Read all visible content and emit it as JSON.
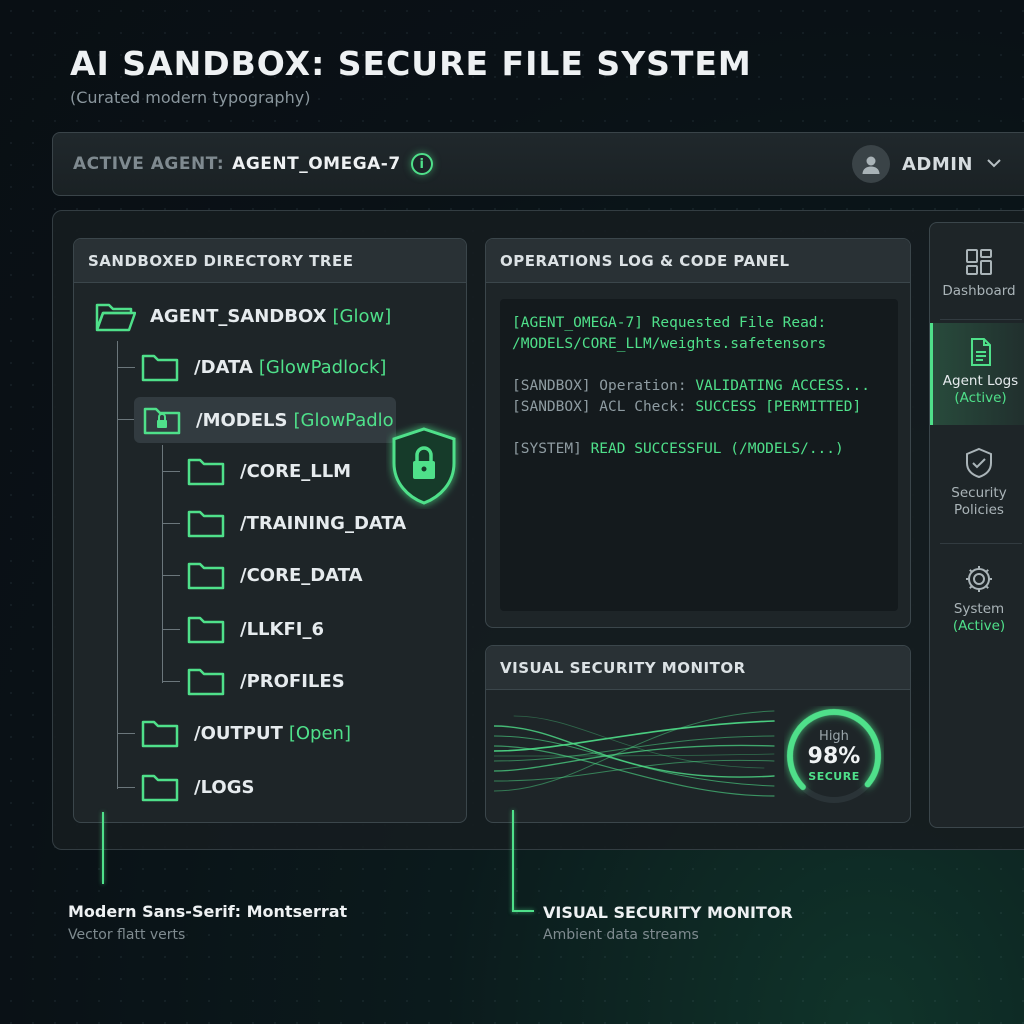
{
  "page": {
    "title": "AI SANDBOX: SECURE FILE SYSTEM",
    "subtitle": "(Curated modern typography)"
  },
  "agent_bar": {
    "label": "ACTIVE AGENT:",
    "agent_name": "AGENT_OMEGA-7",
    "info_icon": "info-icon",
    "user_label": "ADMIN",
    "user_icon": "user-avatar-icon",
    "chevron_icon": "chevron-down-icon"
  },
  "tree_panel": {
    "title": "SANDBOXED DIRECTORY TREE",
    "root": {
      "name": "AGENT_SANDBOX",
      "tag": "[Glow]"
    },
    "items": [
      {
        "name": "/DATA",
        "tag": "[GlowPadlock]"
      },
      {
        "name": "/MODELS",
        "tag": "[GlowPadlo"
      },
      {
        "name": "/CORE_LLM",
        "tag": ""
      },
      {
        "name": "/TRAINING_DATA",
        "tag": ""
      },
      {
        "name": "/CORE_DATA",
        "tag": ""
      },
      {
        "name": "/LLKFI_6",
        "tag": ""
      },
      {
        "name": "/PROFILES",
        "tag": ""
      },
      {
        "name": "/OUTPUT",
        "tag": "[Open]"
      },
      {
        "name": "/LOGS",
        "tag": ""
      }
    ],
    "shield_icon": "shield-lock-icon"
  },
  "log_panel": {
    "title": "OPERATIONS LOG & CODE PANEL",
    "lines": {
      "l1": "[AGENT_OMEGA-7] Requested File Read:",
      "l2": "/MODELS/CORE_LLM/weights.safetensors",
      "l3a": "[SANDBOX] Operation: ",
      "l3b": "VALIDATING ACCESS...",
      "l4a": "[SANDBOX] ACL Check: ",
      "l4b": "SUCCESS [PERMITTED]",
      "l5a": "[SYSTEM] ",
      "l5b": "READ SUCCESSFUL (/MODELS/...)"
    }
  },
  "monitor_panel": {
    "title": "VISUAL SECURITY MONITOR",
    "gauge_level": "High",
    "gauge_value": "98%",
    "gauge_fraction": 0.98,
    "gauge_status": "SECURE"
  },
  "side_nav": {
    "items": [
      {
        "icon": "dashboard-icon",
        "label": "Dashboard",
        "sub": ""
      },
      {
        "icon": "document-icon",
        "label": "Agent Logs",
        "sub": "(Active)"
      },
      {
        "icon": "shield-check-icon",
        "label": "Security\nPolicies",
        "sub": ""
      },
      {
        "icon": "gear-icon",
        "label": "System",
        "sub": "(Active)"
      }
    ]
  },
  "callouts": {
    "left_title": "Modern Sans-Serif: Montserrat",
    "left_sub": "Vector flatt verts",
    "right_title": "VISUAL SECURITY MONITOR",
    "right_sub": "Ambient data streams"
  },
  "colors": {
    "accent": "#4fe08a",
    "background": "#0b1417",
    "panel": "#1e2528"
  }
}
